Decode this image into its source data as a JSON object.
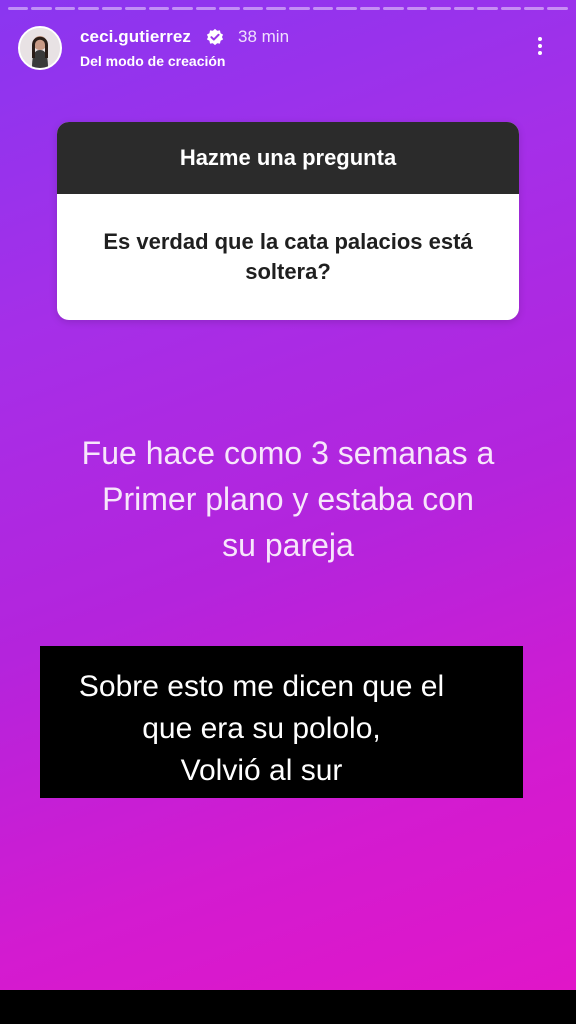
{
  "header": {
    "username": "ceci.gutierrez",
    "time": "38 min",
    "subtitle": "Del modo de creación"
  },
  "progress": {
    "segments": 24,
    "completed": 0
  },
  "question_sticker": {
    "title": "Hazme una pregunta",
    "question": "Es verdad que la cata palacios está soltera?"
  },
  "answer_text": {
    "line1": "Fue hace como 3 semanas a",
    "line2": "Primer plano y estaba con",
    "line3": "su pareja"
  },
  "black_box": {
    "line1": "Sobre esto me dicen que el",
    "line2": "que era su pololo,",
    "line3": "Volvió al sur"
  },
  "icons": [
    "verified-icon",
    "more-options-icon",
    "avatar"
  ],
  "colors": {
    "gradient_start": "#8a36f0",
    "gradient_end": "#e016c8",
    "sticker_header": "#2b2b2b"
  }
}
